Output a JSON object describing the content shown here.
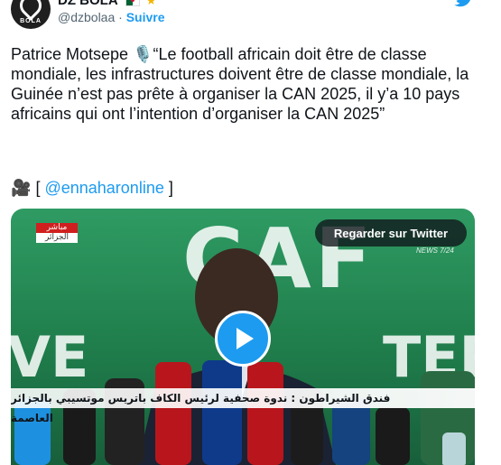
{
  "tweet": {
    "avatar_brand": "BOLA",
    "display_name": "DZ BOLA",
    "handle": "@dzbolaa",
    "separator": "·",
    "follow_label": "Suivre",
    "text": "Patrice Motsepe 🎙️“Le football africain doit être de classe mondiale, les infrastructures doivent être de classe mondiale, la Guinée n’est pas prête à organiser la CAN 2025, il y’a 10 pays africains qui ont l’intention d’organiser la CAN 2025”",
    "camera_emoji": "🎥",
    "bracket_open": "[",
    "mention": "@ennaharonline",
    "bracket_close": "]"
  },
  "media": {
    "watch_button_label": "Regarder sur Twitter",
    "live_top": "مباشر",
    "live_bottom": "الجزائر",
    "news_tag": "NEWS 7/24",
    "caption": "فندق الشيراطون : ندوة صحفية لرئيس الكاف باتريس موتسيبي بالجزائر العاصمة",
    "backdrop_top": "CAF",
    "backdrop_left": "VE",
    "backdrop_right": "TER"
  },
  "colors": {
    "link_blue": "#1d9bf0",
    "backdrop_green": "#2f9b63"
  }
}
